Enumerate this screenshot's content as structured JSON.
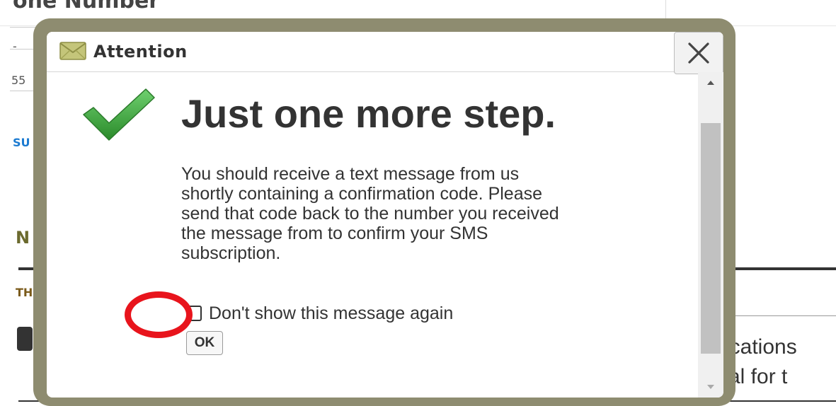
{
  "background": {
    "heading_fragment": "one Number",
    "field_fragment_1": "-",
    "field_fragment_2": "55",
    "link_fragment": "SU",
    "olive_fragment": "N",
    "olive_small_fragment": "TH",
    "right_line_1": "ications",
    "right_line_2": "val for t"
  },
  "dialog": {
    "title": "Attention",
    "title_icon": "envelope-icon",
    "close_label": "×",
    "status_icon": "checkmark-icon",
    "headline": "Just one more step.",
    "body_lines": [
      "You should receive a text message from us",
      "shortly containing a confirmation code. Please",
      "send that code back to the number you received",
      "the message from to confirm your SMS",
      "subscription."
    ],
    "checkbox_label": "Don't show this message again",
    "checkbox_checked": false,
    "ok_label": "OK"
  },
  "annotation": {
    "highlight_color": "#e8141c",
    "highlight_target": "ok-button"
  },
  "colors": {
    "frame": "#8e8c70",
    "check_green": "#3aa33a",
    "envelope": "#b7b86a"
  }
}
